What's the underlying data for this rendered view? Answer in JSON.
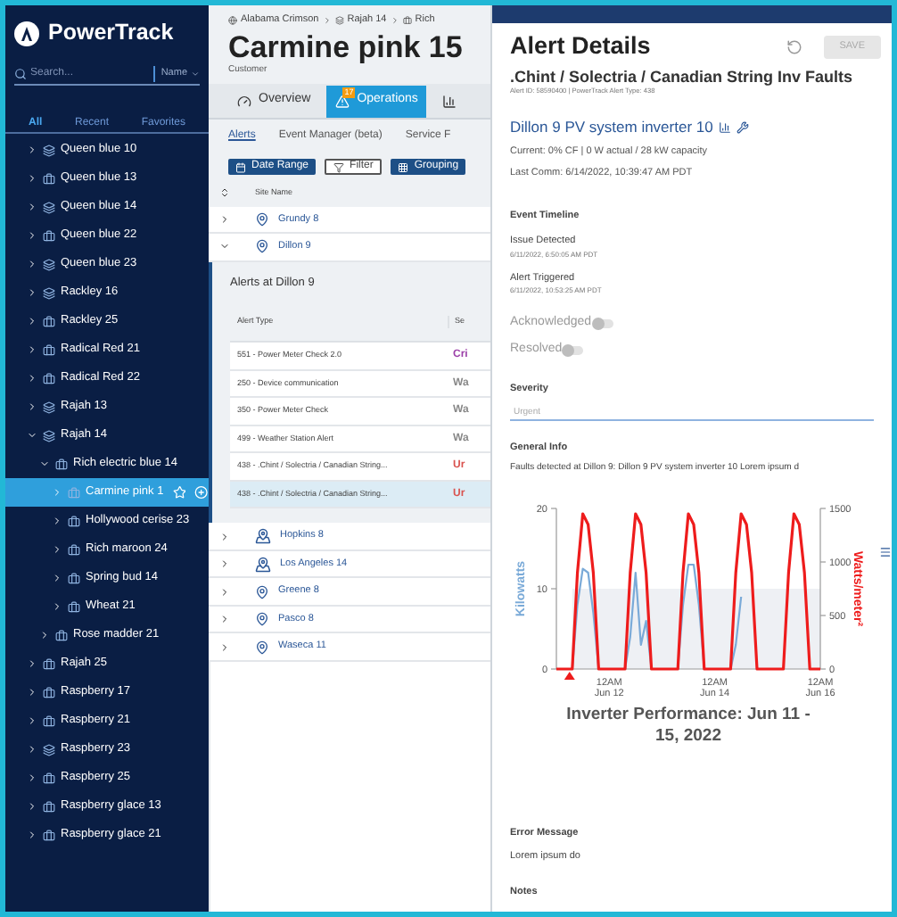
{
  "sidebar": {
    "logo": "PowerTrack",
    "search": {
      "placeholder": "Search..."
    },
    "sort": "Name",
    "tabs": [
      {
        "label": "All",
        "selected": true
      },
      {
        "label": "Recent",
        "selected": false
      },
      {
        "label": "Favorites",
        "selected": false
      }
    ],
    "tree": [
      {
        "label": "Queen blue 10",
        "kind": "group",
        "expanded": false,
        "selected": false
      },
      {
        "label": "Queen blue 13",
        "kind": "site",
        "expanded": false,
        "selected": false
      },
      {
        "label": "Queen blue 14",
        "kind": "group",
        "expanded": false,
        "selected": false
      },
      {
        "label": "Queen blue 22",
        "kind": "site",
        "expanded": false,
        "selected": false
      },
      {
        "label": "Queen blue 23",
        "kind": "group",
        "expanded": false,
        "selected": false
      },
      {
        "label": "Rackley 16",
        "kind": "group",
        "expanded": false,
        "selected": false
      },
      {
        "label": "Rackley 25",
        "kind": "site",
        "expanded": false,
        "selected": false
      },
      {
        "label": "Radical Red 21",
        "kind": "site",
        "expanded": false,
        "selected": false
      },
      {
        "label": "Radical Red 22",
        "kind": "site",
        "expanded": false,
        "selected": false
      },
      {
        "label": "Rajah 13",
        "kind": "group",
        "expanded": false,
        "selected": false
      },
      {
        "label": "Rajah 14",
        "kind": "group",
        "expanded": true,
        "selected": false,
        "children": [
          {
            "label": "Rich electric blue 14",
            "kind": "site",
            "expanded": true,
            "selected": false,
            "children": [
              {
                "label": "Carmine pink 1",
                "kind": "site",
                "expanded": false,
                "selected": true
              },
              {
                "label": "Hollywood cerise 23",
                "kind": "site",
                "expanded": false,
                "selected": false
              },
              {
                "label": "Rich maroon 24",
                "kind": "site",
                "expanded": false,
                "selected": false
              },
              {
                "label": "Spring bud 14",
                "kind": "site",
                "expanded": false,
                "selected": false
              },
              {
                "label": "Wheat 21",
                "kind": "site",
                "expanded": false,
                "selected": false
              }
            ]
          },
          {
            "label": "Rose madder 21",
            "kind": "site",
            "expanded": false,
            "selected": false
          }
        ]
      },
      {
        "label": "Rajah 25",
        "kind": "site",
        "expanded": false,
        "selected": false
      },
      {
        "label": "Raspberry 17",
        "kind": "site",
        "expanded": false,
        "selected": false
      },
      {
        "label": "Raspberry 21",
        "kind": "site",
        "expanded": false,
        "selected": false
      },
      {
        "label": "Raspberry 23",
        "kind": "group",
        "expanded": false,
        "selected": false
      },
      {
        "label": "Raspberry 25",
        "kind": "site",
        "expanded": false,
        "selected": false
      },
      {
        "label": "Raspberry glace 13",
        "kind": "site",
        "expanded": false,
        "selected": false
      },
      {
        "label": "Raspberry glace 21",
        "kind": "site",
        "expanded": false,
        "selected": false
      }
    ]
  },
  "breadcrumb": [
    {
      "label": "Alabama Crimson",
      "kind": "org"
    },
    {
      "label": "Rajah 14",
      "kind": "group"
    },
    {
      "label": "Rich",
      "kind": "site"
    }
  ],
  "page": {
    "title": "Carmine pink 15",
    "subtitle": "Customer"
  },
  "tabs": [
    {
      "label": "Overview",
      "selected": false
    },
    {
      "label": "Operations",
      "badge": "17",
      "selected": true
    },
    {
      "selected": false
    }
  ],
  "subtabs": [
    {
      "label": "Alerts",
      "selected": true
    },
    {
      "label": "Event Manager (beta)",
      "selected": false
    },
    {
      "label": "Service F",
      "selected": false
    }
  ],
  "toolbar": [
    {
      "label": "Date Range",
      "kind": "primary"
    },
    {
      "label": "Filter",
      "kind": "outline"
    },
    {
      "label": "Grouping",
      "kind": "primary"
    }
  ],
  "sites_table": {
    "columns": [
      "Site Name"
    ],
    "rows": [
      {
        "name": "Grundy 8",
        "kind": "site",
        "expanded": false
      },
      {
        "name": "Dillon 9",
        "kind": "site",
        "expanded": true,
        "alerts": {
          "title": "Alerts at Dillon 9",
          "columns": [
            "Alert Type",
            "Se"
          ],
          "rows": [
            {
              "cells": [
                "551 - Power Meter Check 2.0",
                "Cri"
              ],
              "color": "#9b3fa8",
              "selected": false
            },
            {
              "cells": [
                "250 - Device communication",
                "Wa"
              ],
              "color": "#888888",
              "selected": false
            },
            {
              "cells": [
                "350 - Power Meter Check",
                "Wa"
              ],
              "color": "#888888",
              "selected": false
            },
            {
              "cells": [
                "499 - Weather Station Alert",
                "Wa"
              ],
              "color": "#888888",
              "selected": false
            },
            {
              "cells": [
                "438 - .Chint / Solectria / Canadian String...",
                "Ur"
              ],
              "color": "#d9534f",
              "selected": false
            },
            {
              "cells": [
                "438 - .Chint / Solectria / Canadian String...",
                "Ur"
              ],
              "color": "#d9534f",
              "selected": true
            }
          ]
        }
      },
      {
        "name": "Hopkins 8",
        "kind": "group",
        "expanded": false
      },
      {
        "name": "Los Angeles 14",
        "kind": "group",
        "expanded": false
      },
      {
        "name": "Greene 8",
        "kind": "site",
        "expanded": false
      },
      {
        "name": "Pasco 8",
        "kind": "site",
        "expanded": false
      },
      {
        "name": "Waseca 11",
        "kind": "site",
        "expanded": false
      }
    ]
  },
  "alert_details": {
    "title": "Alert Details",
    "save": {
      "label": "SAVE",
      "disabled": true
    },
    "alert_name": ".Chint / Solectria / Canadian String Inv Faults",
    "alert_meta": "Alert ID: 58590400 | PowerTrack Alert Type: 438",
    "device": "Dillon 9 PV system inverter 10",
    "current": "Current: 0% CF | 0 W actual / 28 kW capacity",
    "last_comm": "Last Comm: 6/14/2022, 10:39:47 AM PDT",
    "timeline_heading": "Event Timeline",
    "timeline": [
      {
        "label": "Issue Detected",
        "time": "6/11/2022, 6:50:05 AM PDT"
      },
      {
        "label": "Alert Triggered",
        "time": "6/11/2022, 10:53:25 AM PDT"
      }
    ],
    "toggles": [
      {
        "label": "Acknowledged",
        "on": false
      },
      {
        "label": "Resolved",
        "on": false
      }
    ],
    "severity": {
      "label": "Severity",
      "value": "Urgent"
    },
    "general_info": {
      "heading": "General Info",
      "text": "Faults detected at Dillon 9: Dillon 9 PV system inverter 10 Lorem ipsum d"
    },
    "chart_data": {
      "type": "line",
      "title": "Inverter Performance: Jun 11 - 15, 2022",
      "categories": [
        null,
        null,
        null,
        null,
        null,
        null,
        null,
        null,
        null,
        null,
        "12AM Jun 12",
        null,
        null,
        null,
        null,
        null,
        null,
        null,
        null,
        null,
        null,
        null,
        null,
        null,
        null,
        null,
        null,
        null,
        null,
        null,
        "12AM Jun 14",
        null,
        null,
        null,
        null,
        null,
        null,
        null,
        null,
        null,
        null,
        null,
        null,
        null,
        null,
        null,
        null,
        null,
        null,
        null,
        "12AM Jun 16"
      ],
      "ylim": [
        0,
        20
      ],
      "y2lim": [
        0,
        1500
      ],
      "yticks": [
        0,
        10,
        20
      ],
      "y2ticks": [
        0,
        500,
        1000,
        1500
      ],
      "series": [
        {
          "name": "Kilowatts",
          "color": "#7aaad8",
          "values": [
            null,
            null,
            0,
            0,
            8,
            12.5,
            12,
            7,
            0,
            0,
            0,
            0,
            0,
            0,
            4,
            12,
            3,
            6,
            0,
            0,
            0,
            0,
            0,
            0,
            8,
            13,
            13,
            8,
            0,
            0,
            0,
            0,
            0,
            0,
            3,
            9,
            null,
            null,
            null,
            null,
            null,
            null,
            null,
            null,
            null,
            null,
            null,
            null,
            null,
            null,
            null
          ]
        },
        {
          "name": "Watts/meter²",
          "color": "#ee1c1c",
          "axis": "y2",
          "values": [
            0,
            0,
            0,
            0,
            900,
            1450,
            1350,
            900,
            0,
            0,
            0,
            0,
            0,
            0,
            900,
            1450,
            1350,
            900,
            0,
            0,
            0,
            0,
            0,
            0,
            900,
            1450,
            1350,
            900,
            0,
            0,
            0,
            0,
            0,
            0,
            900,
            1450,
            1350,
            900,
            0,
            0,
            0,
            0,
            0,
            0,
            900,
            1450,
            1350,
            900,
            0,
            0,
            0
          ]
        }
      ]
    },
    "error": {
      "heading": "Error Message",
      "text": "Lorem ipsum do"
    },
    "notes": {
      "heading": "Notes"
    }
  }
}
